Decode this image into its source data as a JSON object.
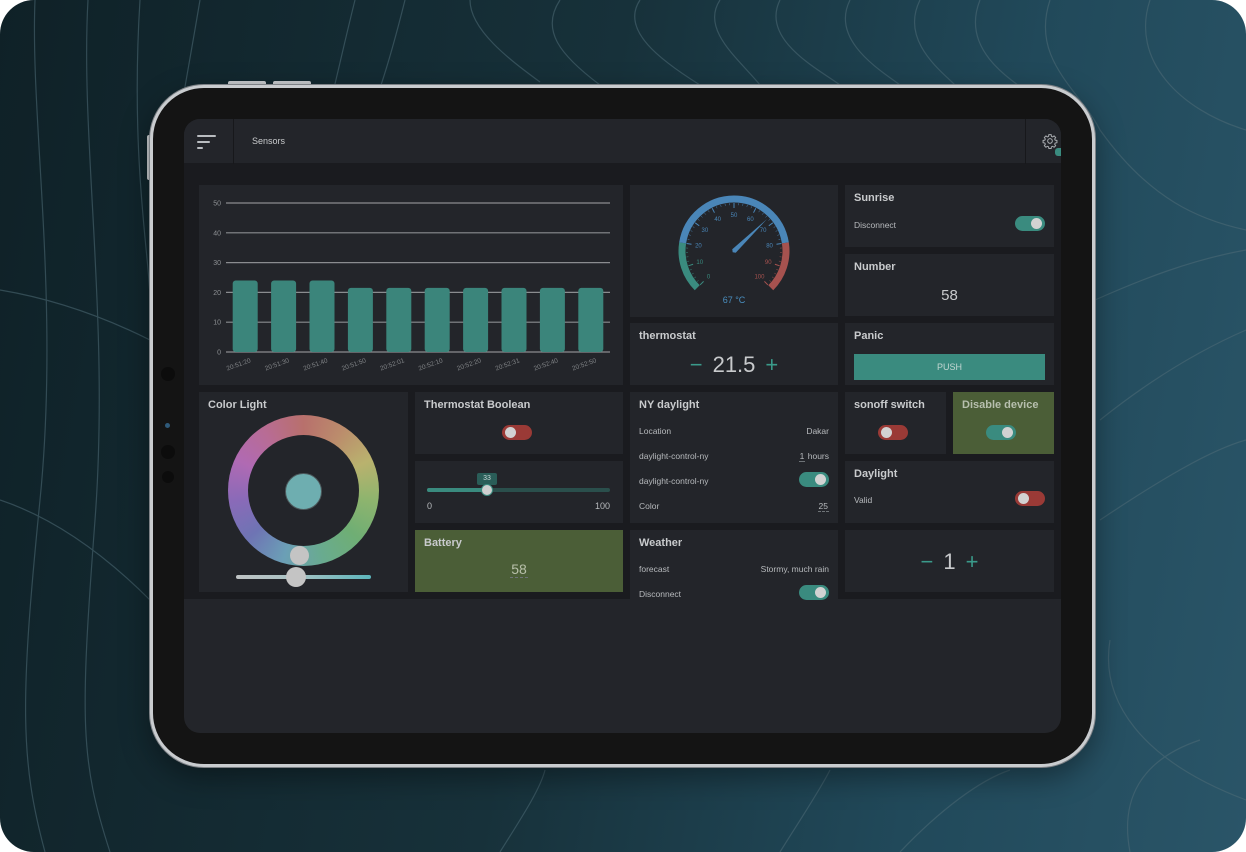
{
  "header": {
    "title": "Sensors",
    "menu_icon": "menu-icon",
    "settings_icon": "gear-icon"
  },
  "chart_data": {
    "type": "bar",
    "title": "",
    "xlabel": "",
    "ylabel": "",
    "ylim": [
      0,
      50
    ],
    "yticks": [
      "0",
      "10",
      "20",
      "30",
      "40",
      "50"
    ],
    "categories": [
      "20:51:20",
      "20:51:30",
      "20:51:40",
      "20:51:50",
      "20:52:01",
      "20:52:10",
      "20:52:20",
      "20:52:31",
      "20:52:40",
      "20:52:50"
    ],
    "values": [
      24,
      24,
      24,
      21.5,
      21.5,
      21.5,
      21.5,
      21.5,
      21.5,
      21.5
    ],
    "grid": true,
    "color": "#3b857b"
  },
  "gauge": {
    "value": 67,
    "unit": "°C",
    "label": "67 °C",
    "min": 0,
    "max": 100,
    "ticks": [
      "0",
      "10",
      "20",
      "30",
      "40",
      "50",
      "60",
      "70",
      "80",
      "90",
      "100"
    ],
    "colors": {
      "low": "#3a8b7f",
      "mid": "#4a86b8",
      "high": "#a6524f"
    }
  },
  "thermostat": {
    "title": "thermostat",
    "value": "21.5",
    "minus": "−",
    "plus": "+"
  },
  "sunrise": {
    "title": "Sunrise",
    "label": "Disconnect",
    "state": "on"
  },
  "number": {
    "title": "Number",
    "value": "58"
  },
  "panic": {
    "title": "Panic",
    "button": "PUSH"
  },
  "color_light": {
    "title": "Color Light",
    "selected_color": "#6eaeb0"
  },
  "thermostat_boolean": {
    "title": "Thermostat Boolean",
    "state": "off"
  },
  "slider": {
    "value": 33,
    "min_label": "0",
    "max_label": "100",
    "value_label": "33"
  },
  "battery": {
    "title": "Battery",
    "value": "58"
  },
  "ny_daylight": {
    "title": "NY daylight",
    "rows": [
      {
        "label": "Location",
        "value": "Dakar"
      },
      {
        "label": "daylight-control-ny",
        "value": "1",
        "unit": "hours"
      },
      {
        "label": "daylight-control-ny",
        "state": "on"
      },
      {
        "label": "Color",
        "value": "25"
      }
    ]
  },
  "weather": {
    "title": "Weather",
    "rows": [
      {
        "label": "forecast",
        "value": "Stormy, much rain"
      },
      {
        "label": "Disconnect",
        "state": "on"
      }
    ]
  },
  "sonoff": {
    "title": "sonoff switch",
    "state": "off"
  },
  "disable_device": {
    "title": "Disable device",
    "state": "on"
  },
  "daylight": {
    "title": "Daylight",
    "label": "Valid",
    "state": "off"
  },
  "counter": {
    "value": "1",
    "minus": "−",
    "plus": "+"
  }
}
